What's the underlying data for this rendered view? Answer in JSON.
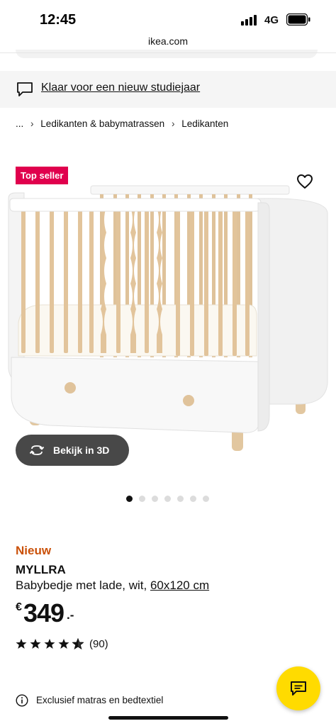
{
  "status_bar": {
    "time": "12:45",
    "network": "4G"
  },
  "browser": {
    "url": "ikea.com"
  },
  "promo": {
    "text": "Klaar voor een nieuw studiejaar"
  },
  "breadcrumb": {
    "items": [
      "...",
      "Ledikanten & babymatrassen",
      "Ledikanten"
    ],
    "separator": "›"
  },
  "product": {
    "badge": "Top seller",
    "view_3d_label": "Bekijk in 3D",
    "gallery": {
      "image_count": 7,
      "active_index": 0
    },
    "new_label": "Nieuw",
    "name": "MYLLRA",
    "description": "Babybedje met lade, wit,",
    "size": "60x120 cm",
    "price": {
      "currency": "€",
      "amount": "349",
      "decimals": ".-"
    },
    "rating": {
      "stars": 4.5,
      "max_stars": 5,
      "review_count": "(90)"
    },
    "info": "Exclusief matras en bedtextiel"
  },
  "colors": {
    "badge": "#e0004d",
    "new": "#ca5008",
    "fab": "#ffdb00",
    "button_3d": "#484848"
  },
  "icons": [
    "signal-icon",
    "battery-icon",
    "chat-bubble-icon",
    "heart-icon",
    "rotate-3d-icon",
    "star-icon",
    "info-icon",
    "chat-icon"
  ]
}
